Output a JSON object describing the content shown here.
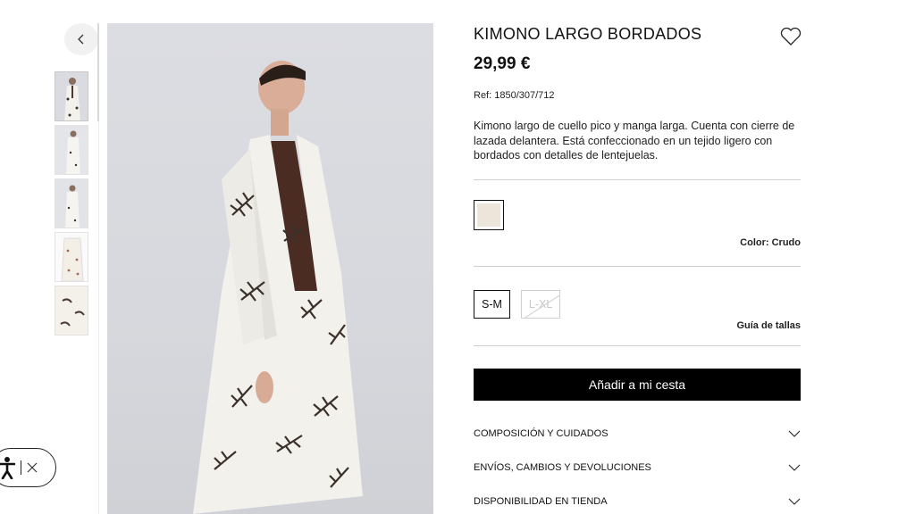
{
  "product": {
    "title": "KIMONO LARGO BORDADOS",
    "price": "29,99 €",
    "ref": "Ref: 1850/307/712",
    "description": "Kimono largo de cuello pico y manga larga. Cuenta con cierre de lazada delantera. Está confeccionado en un tejido ligero con bordados con detalles de lentejuelas.",
    "color_label": "Color: Crudo",
    "swatch_color": "#ece6da",
    "sizes": [
      {
        "label": "S-M",
        "available": true
      },
      {
        "label": "L-XL",
        "available": false
      }
    ],
    "size_guide": "Guía de tallas",
    "add_to_cart": "Añadir a mi cesta"
  },
  "accordion": [
    {
      "label": "COMPOSICIÓN Y CUIDADOS"
    },
    {
      "label": "ENVÍOS, CAMBIOS Y DEVOLUCIONES"
    },
    {
      "label": "DISPONIBILIDAD EN TIENDA"
    }
  ],
  "icons": {
    "back": "chevron-left-icon",
    "wishlist": "heart-icon",
    "accordion": "chevron-down-icon",
    "accessibility": "accessibility-icon",
    "close": "close-icon"
  },
  "colors": {
    "button_bg": "#000000",
    "button_text": "#ffffff",
    "garment": "#f3f1ec",
    "embroidery": "#3b302a"
  }
}
